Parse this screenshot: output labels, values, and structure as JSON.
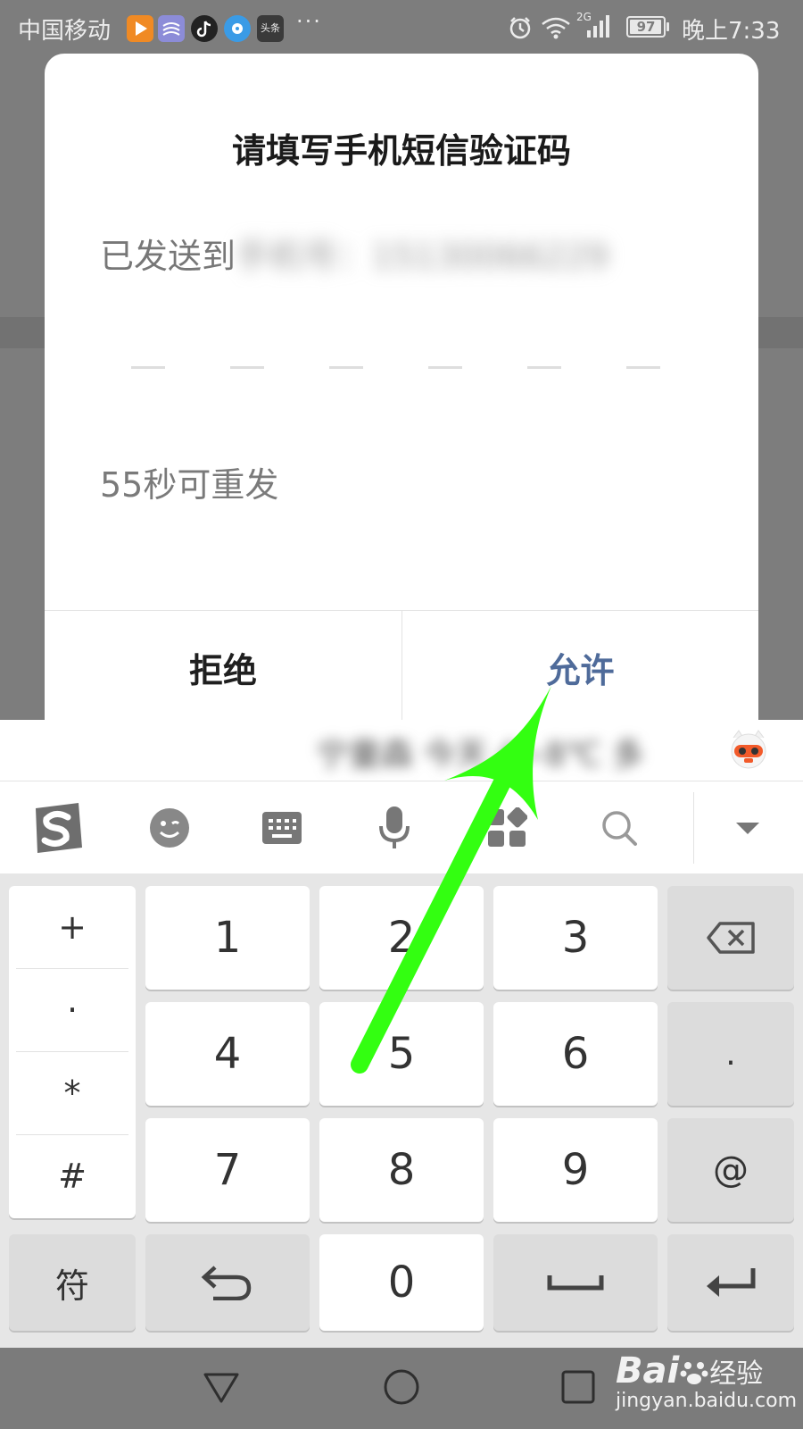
{
  "status_bar": {
    "carrier": "中国移动",
    "more": "···",
    "network": "2G",
    "battery": "97",
    "battery_level": 0.97,
    "time": "晚上7:33",
    "app_icons": [
      "video-app-icon",
      "weather-app-icon",
      "tiktok-icon",
      "music-app-icon",
      "toutiao-icon"
    ],
    "toutiao_label": "头条"
  },
  "dialog": {
    "title": "请填写手机短信验证码",
    "sent_to_prefix": "已发送到",
    "sent_to_phone": "手机号：15130066229",
    "resend_timer": "55秒可重发",
    "deny_label": "拒绝",
    "allow_label": "允许",
    "accent": "#4f6b9a"
  },
  "keyboard": {
    "candidate_text": "宁童森 今天 4~8℃ 多",
    "toolbar": [
      "sogou-logo-icon",
      "emoji-icon",
      "keyboard-icon",
      "microphone-icon",
      "apps-grid-icon",
      "search-icon",
      "collapse-icon"
    ],
    "symbols": [
      "+",
      "·",
      "*",
      "#"
    ],
    "digit_rows": [
      [
        "1",
        "2",
        "3"
      ],
      [
        "4",
        "5",
        "6"
      ],
      [
        "7",
        "8",
        "9"
      ]
    ],
    "right_keys": [
      "backspace-icon",
      ".",
      "@"
    ],
    "bottom_row": {
      "symbols": "符",
      "zero": "0"
    }
  },
  "nav_bar": {
    "buttons": [
      "back-icon",
      "home-icon",
      "recents-icon"
    ]
  },
  "watermark": {
    "brand": "Bai",
    "brand_tail": "经验",
    "url": "jingyan.baidu.com"
  },
  "annotation": {
    "color": "#33ff11"
  }
}
